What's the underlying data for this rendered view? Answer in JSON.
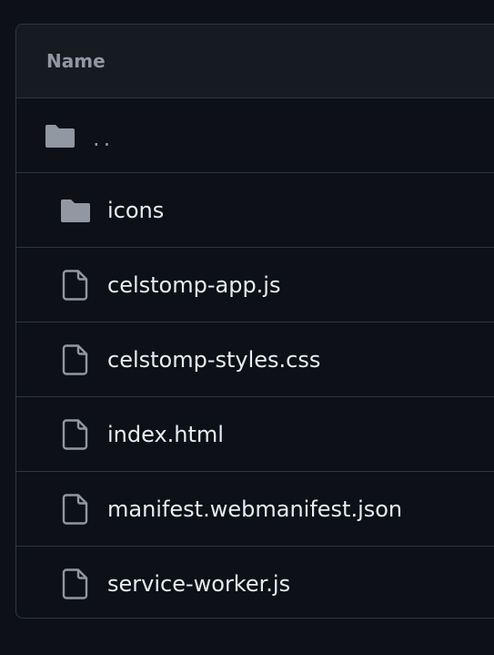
{
  "table": {
    "header": "Name",
    "parent": {
      "label": "..",
      "icon": "folder-icon"
    },
    "entries": [
      {
        "label": "icons",
        "icon": "folder-icon",
        "type": "directory"
      },
      {
        "label": "celstomp-app.js",
        "icon": "file-icon",
        "type": "file"
      },
      {
        "label": "celstomp-styles.css",
        "icon": "file-icon",
        "type": "file"
      },
      {
        "label": "index.html",
        "icon": "file-icon",
        "type": "file"
      },
      {
        "label": "manifest.webmanifest.json",
        "icon": "file-icon",
        "type": "file"
      },
      {
        "label": "service-worker.js",
        "icon": "file-icon",
        "type": "file"
      }
    ]
  },
  "colors": {
    "background": "#0d1117",
    "header_background": "#161b22",
    "border": "#30363d",
    "text": "#e6edf3",
    "muted_text": "#9198a1",
    "folder_icon": "#9198a1"
  }
}
